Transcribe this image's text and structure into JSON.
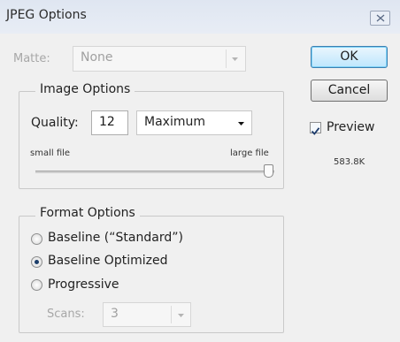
{
  "window": {
    "title": "JPEG Options",
    "close_icon": "close-x-icon"
  },
  "matte": {
    "label": "Matte:",
    "value": "None"
  },
  "buttons": {
    "ok": "OK",
    "cancel": "Cancel"
  },
  "preview": {
    "label": "Preview",
    "checked": true,
    "file_size": "583.8K"
  },
  "image_options": {
    "title": "Image Options",
    "quality_label": "Quality:",
    "quality_value": "12",
    "quality_preset": "Maximum",
    "small_file_label": "small file",
    "large_file_label": "large file",
    "slider_level_fraction": 1.0
  },
  "format_options": {
    "title": "Format Options",
    "options": [
      {
        "label": "Baseline (“Standard”)",
        "selected": false
      },
      {
        "label": "Baseline Optimized",
        "selected": true
      },
      {
        "label": "Progressive",
        "selected": false
      }
    ],
    "scans_label": "Scans:",
    "scans_value": "3"
  },
  "colors": {
    "default_button_border": "#3c7fb1",
    "titlebar": "#dfe6f1"
  }
}
